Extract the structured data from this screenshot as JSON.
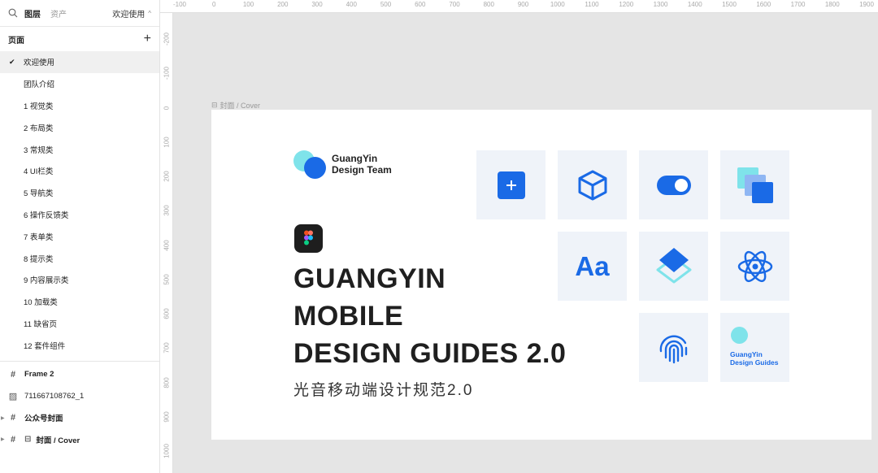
{
  "sidebar": {
    "tabs": [
      "图层",
      "资产"
    ],
    "page_selector": "欢迎使用",
    "pages_header": "页面",
    "pages": [
      {
        "label": "欢迎使用",
        "active": true
      },
      {
        "label": "团队介绍"
      },
      {
        "label": "1 视觉类"
      },
      {
        "label": "2 布局类"
      },
      {
        "label": "3 常规类"
      },
      {
        "label": "4 UI栏类"
      },
      {
        "label": "5 导航类"
      },
      {
        "label": "6 操作反馈类"
      },
      {
        "label": "7 表单类"
      },
      {
        "label": "8 提示类"
      },
      {
        "label": "9 内容展示类"
      },
      {
        "label": "10 加载类"
      },
      {
        "label": "11 缺省页"
      },
      {
        "label": "12 套件组件"
      }
    ],
    "layers": [
      {
        "label": "Frame 2",
        "icon": "frame-icon",
        "bold": true
      },
      {
        "label": "711667108762_1",
        "icon": "image-icon",
        "bold": false
      },
      {
        "label": "公众号封面",
        "icon": "frame-icon",
        "bold": true,
        "collapsed": true
      },
      {
        "label": "封面 / Cover",
        "icon": "frame-icon",
        "bold": true,
        "collapsed": true,
        "component": true
      }
    ]
  },
  "ruler": {
    "top": [
      "-100",
      "0",
      "100",
      "200",
      "300",
      "400",
      "500",
      "600",
      "700",
      "800",
      "900",
      "1000",
      "1100",
      "1200",
      "1300",
      "1400",
      "1500",
      "1600",
      "1700",
      "1800",
      "1900"
    ],
    "left": [
      "-200",
      "-100",
      "0",
      "100",
      "200",
      "300",
      "400",
      "500",
      "600",
      "700",
      "800",
      "900",
      "1000"
    ]
  },
  "canvas": {
    "frame_label": "封面 / Cover",
    "logo_line1": "GuangYin",
    "logo_line2": "Design Team",
    "headline": [
      "GUANGYIN",
      "MOBILE",
      "DESIGN GUIDES 2.0"
    ],
    "subhead": "光音移动端设计规范2.0",
    "aa_text": "Aa",
    "guides_line1": "GuangYin",
    "guides_line2": "Design Guides"
  },
  "colors": {
    "accent": "#1a6ae6",
    "accent_light": "#7fe3ea",
    "tile_bg": "#eff3f9"
  }
}
